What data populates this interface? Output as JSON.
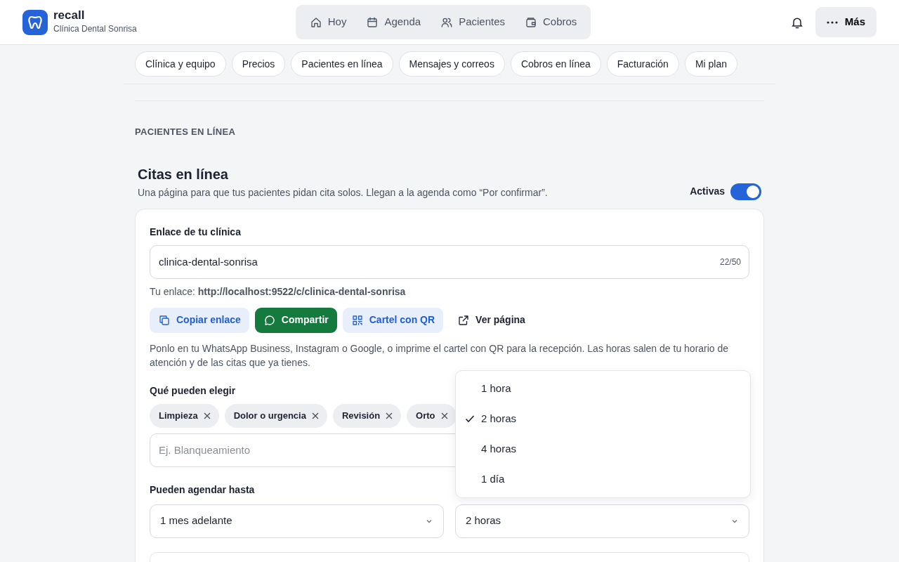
{
  "app": {
    "name": "recall",
    "clinic": "Clínica Dental Sonrisa"
  },
  "nav": [
    {
      "label": "Hoy",
      "kind": "home"
    },
    {
      "label": "Agenda",
      "kind": "calendar"
    },
    {
      "label": "Pacientes",
      "kind": "people"
    },
    {
      "label": "Cobros",
      "kind": "wallet"
    }
  ],
  "more_button": {
    "label": "Más"
  },
  "settings_tabs": [
    {
      "label": "Clínica y equipo"
    },
    {
      "label": "Precios"
    },
    {
      "label": "Pacientes en línea"
    },
    {
      "label": "Mensajes y correos"
    },
    {
      "label": "Cobros en línea"
    },
    {
      "label": "Facturación"
    },
    {
      "label": "Mi plan"
    }
  ],
  "section_label": "PACIENTES EN LÍNEA",
  "heading": "Citas en línea",
  "description": "Una página para que tus pacientes pidan cita solos. Llegan a la agenda como “Por confirmar”.",
  "active_toggle": {
    "label": "Activas",
    "on": true
  },
  "link_field": {
    "label": "Enlace de tu clínica",
    "value": "clinica-dental-sonrisa",
    "counter": "22/50"
  },
  "link_line": "Tu enlace: **http://localhost:9522/c/clinica-dental-sonrisa**",
  "actions": [
    {
      "label": "Copiar enlace",
      "kind": "copy"
    },
    {
      "label": "Compartir",
      "kind": "share"
    },
    {
      "label": "Cartel con QR",
      "kind": "qr"
    },
    {
      "label": "Ver página",
      "kind": "external"
    }
  ],
  "help": "Ponlo en tu WhatsApp Business, Instagram o Google, o imprime el cartel con QR para la recepción. Las horas salen de tu horario de atención y de las citas que ya tienes.",
  "choices": {
    "label": "Qué pueden elegir",
    "chips": [
      {
        "label": "Limpieza"
      },
      {
        "label": "Dolor o urgencia"
      },
      {
        "label": "Revisión"
      },
      {
        "label": "Orto"
      }
    ],
    "placeholder": "Ej. Blanqueamiento"
  },
  "booking": {
    "label": "Pueden agendar hasta",
    "horizon": "1 mes adelante",
    "notice": "2 horas"
  },
  "notice_menu": [
    {
      "label": "1 hora",
      "selected": false
    },
    {
      "label": "2 horas",
      "selected": true
    },
    {
      "label": "4 horas",
      "selected": false
    },
    {
      "label": "1 día",
      "selected": false
    }
  ]
}
